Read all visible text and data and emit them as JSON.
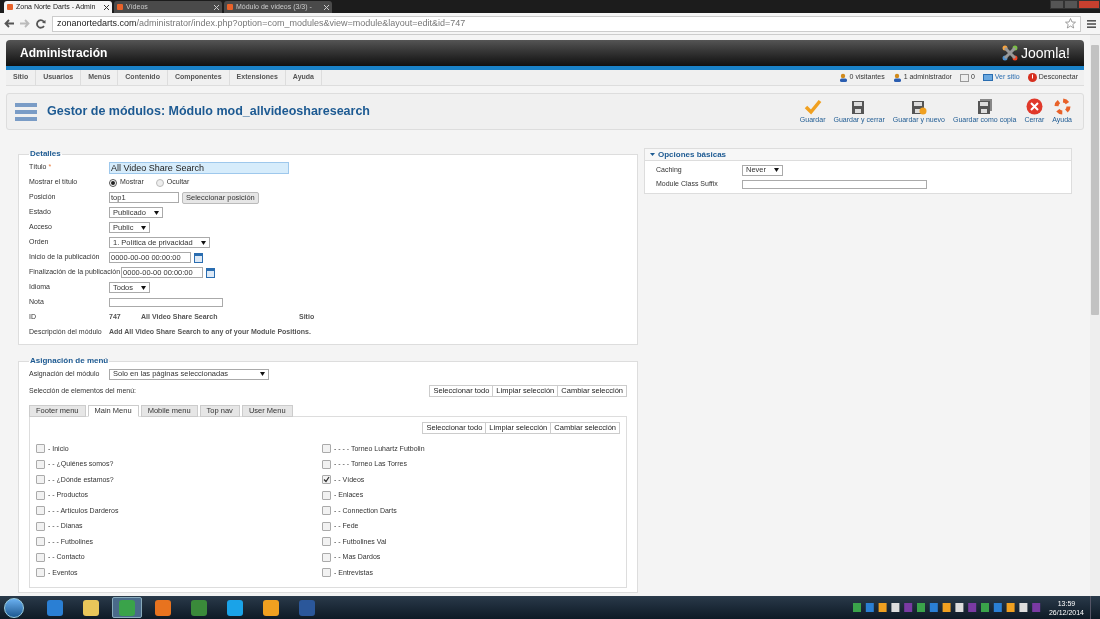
{
  "browser": {
    "tabs": [
      {
        "title": "Zona Norte Darts - Admin",
        "selected": true
      },
      {
        "title": "Vídeos",
        "selected": false
      },
      {
        "title": "Módulo de vídeos (3/3) - ",
        "selected": false
      }
    ],
    "url_host": "zonanortedarts.com",
    "url_path": "/administrator/index.php?option=com_modules&view=module&layout=edit&id=747"
  },
  "header": {
    "title": "Administración",
    "logo": "Joomla!"
  },
  "nav": {
    "menu": [
      "Sitio",
      "Usuarios",
      "Menús",
      "Contenido",
      "Componentes",
      "Extensiones",
      "Ayuda"
    ],
    "status": [
      {
        "kind": "users",
        "text": "0 visitantes"
      },
      {
        "kind": "users",
        "text": "1 administrador"
      },
      {
        "kind": "mail",
        "text": "0"
      },
      {
        "kind": "view",
        "text": "Ver sitio"
      },
      {
        "kind": "logout",
        "text": "Desconectar"
      }
    ]
  },
  "toolbar": {
    "title": "Gestor de módulos: Módulo mod_allvideosharesearch",
    "buttons": [
      {
        "kind": "save",
        "label": "Guardar"
      },
      {
        "kind": "disk",
        "label": "Guardar y cerrar"
      },
      {
        "kind": "disk_plus",
        "label": "Guardar y nuevo"
      },
      {
        "kind": "disk_copy",
        "label": "Guardar como copia"
      },
      {
        "kind": "close",
        "label": "Cerrar"
      },
      {
        "kind": "help",
        "label": "Ayuda"
      }
    ]
  },
  "details": {
    "legend": "Detalles",
    "rows": [
      {
        "kind": "text",
        "label": "Título",
        "required_mark": "*",
        "value": "All Video Share Search",
        "focused": true
      },
      {
        "kind": "radio",
        "label": "Mostrar el título",
        "options": [
          {
            "label": "Mostrar",
            "selected": true
          },
          {
            "label": "Ocultar",
            "selected": false
          }
        ]
      },
      {
        "kind": "text_button",
        "label": "Posición",
        "value": "top1",
        "button": "Seleccionar posición"
      },
      {
        "kind": "select",
        "label": "Estado",
        "value": "Publicado"
      },
      {
        "kind": "select",
        "label": "Acceso",
        "value": "Public"
      },
      {
        "kind": "select",
        "label": "Orden",
        "value": "1. Política de privacidad"
      },
      {
        "kind": "date",
        "label": "Inicio de la publicación",
        "value": "0000-00-00 00:00:00"
      },
      {
        "kind": "date",
        "label": "Finalización de la publicación",
        "value": "0000-00-00 00:00:00"
      },
      {
        "kind": "select",
        "label": "Idioma",
        "value": "Todos"
      },
      {
        "kind": "text",
        "label": "Nota",
        "value": "",
        "focused": false
      },
      {
        "kind": "info",
        "label": "ID",
        "values": [
          "747",
          "All Video Share Search",
          "Sitio"
        ]
      },
      {
        "kind": "info",
        "label": "Descripción del módulo",
        "values": [
          "Add All Video Share Search to any of your Module Positions."
        ]
      }
    ]
  },
  "basic_options": {
    "title": "Opciones básicas",
    "expanded": true,
    "rows": [
      {
        "kind": "select",
        "label": "Caching",
        "value": "Never"
      },
      {
        "kind": "text",
        "label": "Module Class Suffix",
        "value": ""
      }
    ]
  },
  "menu_assignment": {
    "legend": "Asignación de menú",
    "assignment_label": "Asignación del módulo",
    "assignment_value": "Solo en las páginas seleccionadas",
    "selection_label": "Selección de elementos del menú:",
    "actions": [
      "Seleccionar todo",
      "Limpiar selección",
      "Cambiar selección"
    ],
    "tabs": [
      {
        "label": "Footer menu",
        "selected": false
      },
      {
        "label": "Main Menu",
        "selected": true
      },
      {
        "label": "Mobile menu",
        "selected": false
      },
      {
        "label": "Top nav",
        "selected": false
      },
      {
        "label": "User Menu",
        "selected": false
      }
    ],
    "tab_actions": [
      "Seleccionar todo",
      "Limpiar selección",
      "Cambiar selección"
    ],
    "columns": [
      [
        {
          "label": "- Inicio",
          "checked": false
        },
        {
          "label": "- - ¿Quiénes somos?",
          "checked": false
        },
        {
          "label": "- - ¿Dónde estamos?",
          "checked": false
        },
        {
          "label": "- - Productos",
          "checked": false
        },
        {
          "label": "- - - Artículos Darderos",
          "checked": false
        },
        {
          "label": "- - - Dianas",
          "checked": false
        },
        {
          "label": "- - - Futbolines",
          "checked": false
        },
        {
          "label": "- - Contacto",
          "checked": false
        },
        {
          "label": "- Eventos",
          "checked": false
        }
      ],
      [
        {
          "label": "- - - - Torneo Luhartz Futbolin",
          "checked": false
        },
        {
          "label": "- - - - Torneo Las Torres",
          "checked": false
        },
        {
          "label": "- - Vídeos",
          "checked": true
        },
        {
          "label": "- Enlaces",
          "checked": false
        },
        {
          "label": "- - Connection Darts",
          "checked": false
        },
        {
          "label": "- - Fede",
          "checked": false
        },
        {
          "label": "- - Futbolines Val",
          "checked": false
        },
        {
          "label": "- - Mas Dardos",
          "checked": false
        },
        {
          "label": "- Entrevistas",
          "checked": false
        }
      ]
    ]
  },
  "taskbar": {
    "apps": [
      {
        "kind": "dropbox",
        "selected": false
      },
      {
        "kind": "folder",
        "selected": false
      },
      {
        "kind": "chrome",
        "selected": true
      },
      {
        "kind": "firefox",
        "selected": false
      },
      {
        "kind": "network",
        "selected": false
      },
      {
        "kind": "skype",
        "selected": false
      },
      {
        "kind": "mail",
        "selected": false
      },
      {
        "kind": "word",
        "selected": false
      }
    ],
    "time": "13:59",
    "date": "26/12/2014"
  }
}
